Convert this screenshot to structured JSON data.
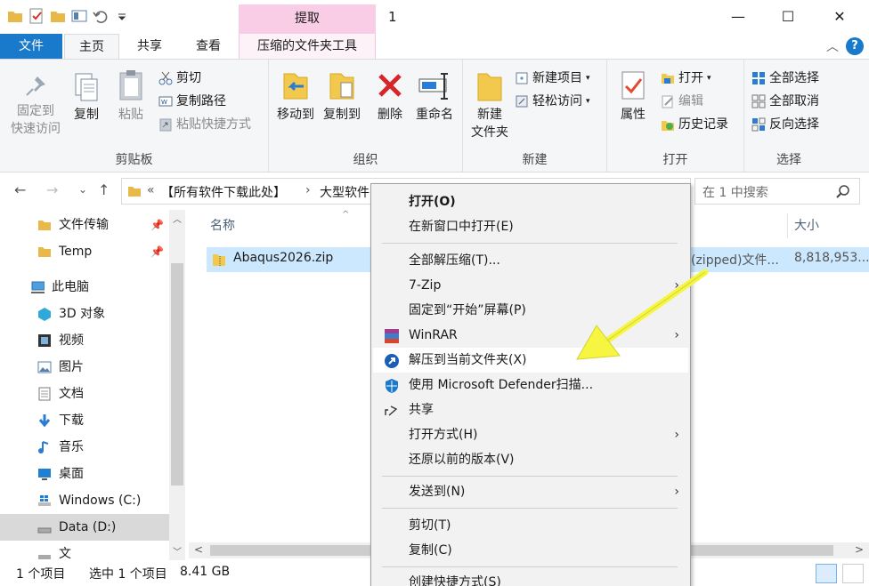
{
  "window": {
    "title": "1",
    "context_tab_header": "提取"
  },
  "tabs": {
    "file": "文件",
    "home": "主页",
    "share": "共享",
    "view": "查看",
    "compressed_tools": "压缩的文件夹工具"
  },
  "ribbon": {
    "clipboard": {
      "label": "剪贴板",
      "pin_quick_access_1": "固定到",
      "pin_quick_access_2": "快速访问",
      "copy": "复制",
      "paste": "粘贴",
      "cut": "剪切",
      "copy_path": "复制路径",
      "paste_shortcut": "粘贴快捷方式"
    },
    "organize": {
      "label": "组织",
      "move_to": "移动到",
      "copy_to": "复制到",
      "delete": "删除",
      "rename": "重命名"
    },
    "new": {
      "label": "新建",
      "new_folder_1": "新建",
      "new_folder_2": "文件夹",
      "new_item": "新建项目",
      "easy_access": "轻松访问"
    },
    "open": {
      "label": "打开",
      "properties": "属性",
      "open": "打开",
      "edit": "编辑",
      "history": "历史记录"
    },
    "select": {
      "label": "选择",
      "select_all": "全部选择",
      "select_none": "全部取消",
      "invert": "反向选择"
    }
  },
  "address": {
    "chevron": "«",
    "crumb1": "【所有软件下载此处】",
    "sep": "›",
    "crumb2": "大型软件",
    "search_placeholder": "在 1 中搜索"
  },
  "navpane": {
    "items": [
      {
        "label": "文件传输",
        "pinned": true
      },
      {
        "label": "Temp",
        "pinned": true
      },
      {
        "label": "此电脑"
      },
      {
        "label": "3D 对象"
      },
      {
        "label": "视频"
      },
      {
        "label": "图片"
      },
      {
        "label": "文档"
      },
      {
        "label": "下载"
      },
      {
        "label": "音乐"
      },
      {
        "label": "桌面"
      },
      {
        "label": "Windows (C:)"
      },
      {
        "label": "Data (D:)"
      },
      {
        "label": "文"
      }
    ]
  },
  "filelist": {
    "col_name": "名称",
    "col_size": "大小",
    "file": {
      "name": "Abaqus2026.zip",
      "type": "(zipped)文件...",
      "size": "8,818,953..."
    }
  },
  "status": {
    "count": "1 个项目",
    "selected": "选中 1 个项目",
    "size": "8.41 GB"
  },
  "context_menu": {
    "items": [
      {
        "label": "打开(O)",
        "bold": true
      },
      {
        "label": "在新窗口中打开(E)"
      },
      {
        "label": "全部解压缩(T)..."
      },
      {
        "label": "7-Zip",
        "submenu": true
      },
      {
        "label": "固定到“开始”屏幕(P)"
      },
      {
        "label": "WinRAR",
        "submenu": true,
        "icon": "winrar-icon"
      },
      {
        "label": "解压到当前文件夹(X)",
        "icon": "extract-icon",
        "highlighted": true
      },
      {
        "label": "使用 Microsoft Defender扫描...",
        "icon": "defender-icon"
      },
      {
        "label": "共享",
        "icon": "share-icon"
      },
      {
        "label": "打开方式(H)",
        "submenu": true
      },
      {
        "label": "还原以前的版本(V)"
      },
      {
        "label": "发送到(N)",
        "submenu": true
      },
      {
        "label": "剪切(T)"
      },
      {
        "label": "复制(C)"
      },
      {
        "label": "创建快捷方式(S)"
      }
    ]
  },
  "colors": {
    "accent": "#1979ca",
    "context_tab": "#f9cde6",
    "selection": "#cce8ff",
    "arrow": "#f5f542"
  }
}
